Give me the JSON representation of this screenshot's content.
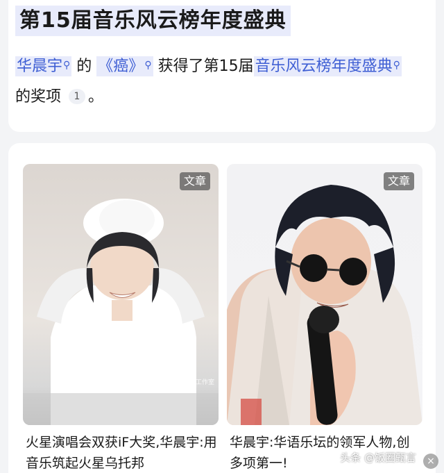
{
  "top": {
    "title": "第15届音乐风云榜年度盛典",
    "artist_link": "华晨宇",
    "t_of": "的",
    "song_link": "《癌》",
    "t_won": "获得了第15届",
    "event_link": "音乐风云榜年度盛典",
    "t_award": "的奖项",
    "citation": "1",
    "t_end": "。",
    "search_icon": "search-icon"
  },
  "articles": [
    {
      "badge": "文章",
      "title": "火星演唱会双获iF大奖,华晨宇:用音乐筑起火星乌托邦",
      "image_watermark": "@ 华晨宇工作室"
    },
    {
      "badge": "文章",
      "title": "华晨宇:华语乐坛的领军人物,创多项第一!"
    }
  ],
  "footer": {
    "watermark": "头条 @饭圈甄言",
    "close_icon": "close-icon"
  },
  "colors": {
    "link": "#3f5fd4",
    "highlight": "#e8ebfb"
  }
}
